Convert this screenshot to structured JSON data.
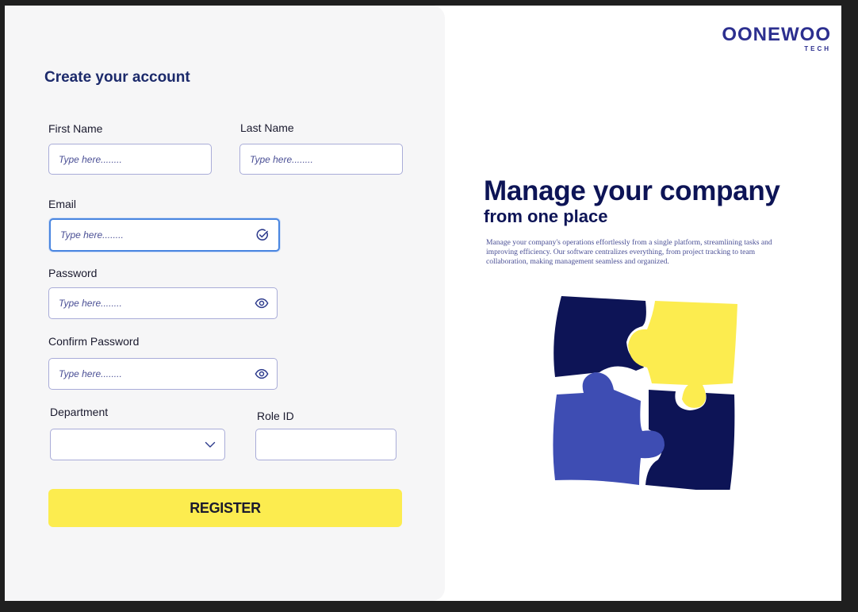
{
  "form": {
    "title": "Create your account",
    "first_name_label": "First Name",
    "last_name_label": "Last Name",
    "email_label": "Email",
    "password_label": "Password",
    "confirm_password_label": "Confirm Password",
    "department_label": "Department",
    "role_id_label": "Role ID",
    "placeholder": "Type here........",
    "department_value": "",
    "role_id_value": "",
    "register_label": "REGISTER"
  },
  "brand": {
    "logo_text": "OONEWOO",
    "logo_subtext": "TECH"
  },
  "hero": {
    "headline": "Manage your company",
    "subheadline": "from one place",
    "description": "Manage your company's operations effortlessly from a single platform, streamlining tasks and improving efficiency. Our software centralizes everything, from project tracking to team collaboration, making management seamless and organized."
  },
  "colors": {
    "navy": "#0d1456",
    "yellow": "#fcec4f",
    "blue": "#3e4db3",
    "focus_border": "#4a86e0",
    "panel_bg": "#f6f6f7"
  },
  "icons": {
    "email_status": "check-circle-icon",
    "password_toggle": "eye-icon",
    "confirm_password_toggle": "eye-icon",
    "department_dropdown": "chevron-down-icon"
  }
}
